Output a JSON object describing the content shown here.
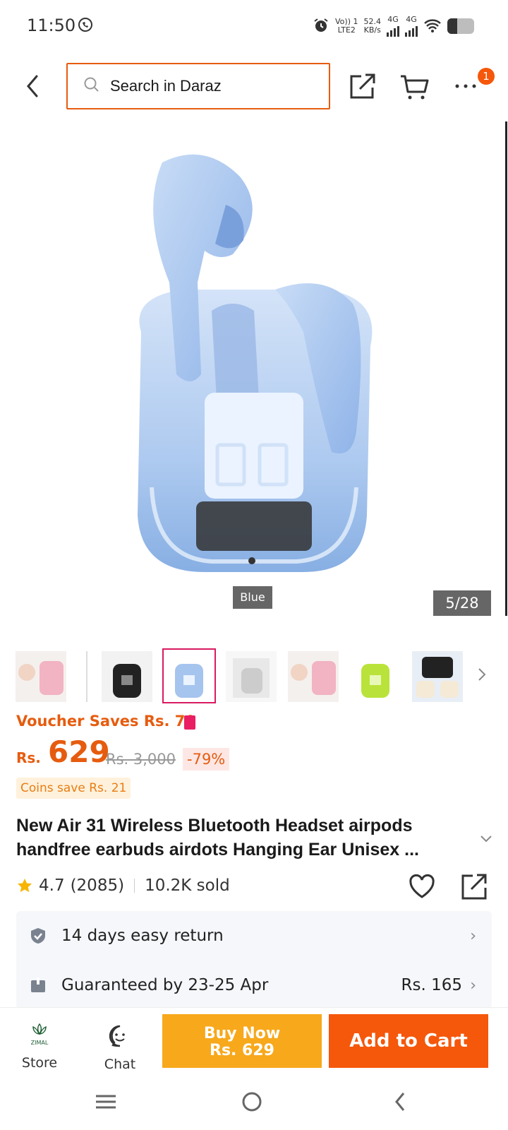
{
  "status_bar": {
    "time": "11:50",
    "volte": "Vo)) 1",
    "lte": "LTE2",
    "speed": "52.4",
    "speed_unit": "KB/s",
    "net1": "4G",
    "net2": "4G"
  },
  "header": {
    "search_placeholder": "Search in Daraz",
    "cart_badge": "1"
  },
  "gallery": {
    "color_label": "Blue",
    "counter": "5/28",
    "thumbnail_count": 7,
    "selected_thumbnail": 2
  },
  "product": {
    "voucher": "Voucher Saves Rs. 70",
    "currency": "Rs.",
    "price": "629",
    "original_price": "Rs. 3,000",
    "discount": "-79%",
    "coins": "Coins save Rs. 21",
    "title": "New Air 31 Wireless Bluetooth Headset airpods handfree earbuds airdots Hanging Ear Unisex ...",
    "rating": "4.7",
    "reviews": "(2085)",
    "sold": "10.2K sold"
  },
  "info": {
    "return_label": "14 days easy return",
    "delivery_label": "Guaranteed by 23-25 Apr",
    "delivery_fee": "Rs. 165"
  },
  "bottom_bar": {
    "store_label": "Store",
    "store_logo": "ZIMAL",
    "chat_label": "Chat",
    "buy_now_label": "Buy Now",
    "buy_now_price": "Rs. 629",
    "add_to_cart_label": "Add to Cart"
  },
  "colors": {
    "accent": "#f5570b",
    "buy_now": "#f7a81b",
    "product_blue": "#a9c7f0"
  }
}
